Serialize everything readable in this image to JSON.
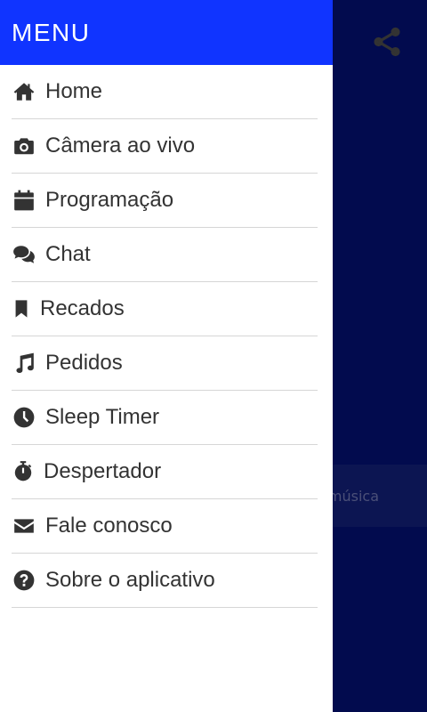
{
  "drawer": {
    "header_title": "MENU",
    "items": [
      {
        "label": "Home",
        "icon": "home-icon"
      },
      {
        "label": "Câmera ao vivo",
        "icon": "camera-icon"
      },
      {
        "label": "Programação",
        "icon": "calendar-icon"
      },
      {
        "label": "Chat",
        "icon": "chat-icon"
      },
      {
        "label": "Recados",
        "icon": "bookmark-icon"
      },
      {
        "label": "Pedidos",
        "icon": "music-note-icon"
      },
      {
        "label": "Sleep Timer",
        "icon": "clock-icon"
      },
      {
        "label": "Despertador",
        "icon": "stopwatch-icon"
      },
      {
        "label": "Fale conosco",
        "icon": "envelope-icon"
      },
      {
        "label": "Sobre o aplicativo",
        "icon": "question-icon"
      }
    ]
  },
  "background": {
    "now_playing_text": "a música",
    "share_icon": "share-icon"
  },
  "colors": {
    "header": "#1034ff",
    "background": "#020b4e",
    "text": "#333333",
    "divider": "#d6d6d6"
  }
}
